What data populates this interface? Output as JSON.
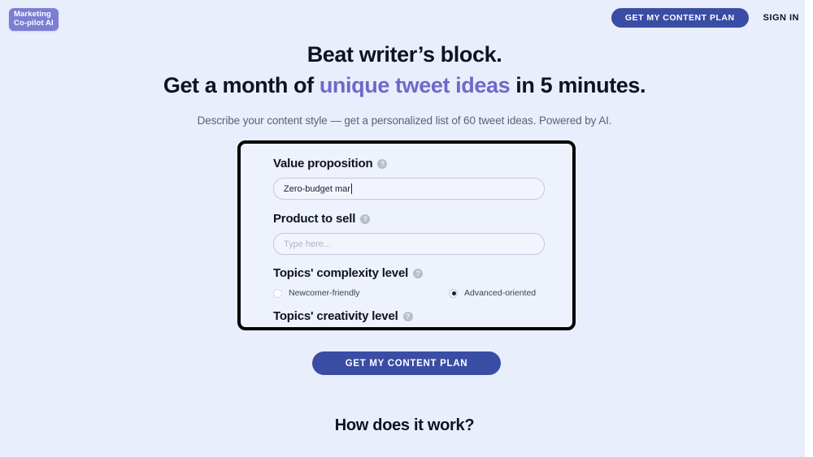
{
  "header": {
    "logo_text": "Marketing\nCo-pilot AI",
    "cta_label": "GET MY CONTENT PLAN",
    "signin_label": "SIGN IN"
  },
  "hero": {
    "headline_line1": "Beat writer’s block.",
    "headline_line2_before": "Get a month of ",
    "headline_line2_accent": "unique tweet ideas",
    "headline_line2_after": " in 5 minutes.",
    "subtitle": "Describe your content style — get a personalized list of 60 tweet ideas. Powered by AI."
  },
  "form": {
    "help_glyph": "?",
    "fields": [
      {
        "label": "Value proposition",
        "value": "Zero-budget mar",
        "placeholder": "Type here..."
      },
      {
        "label": "Product to sell",
        "value": "",
        "placeholder": "Type here..."
      }
    ],
    "complexity": {
      "label": "Topics' complexity level",
      "options": [
        {
          "label": "Newcomer-friendly",
          "selected": false
        },
        {
          "label": "Advanced-oriented",
          "selected": true
        }
      ]
    },
    "creativity": {
      "label": "Topics' creativity level"
    }
  },
  "cta": {
    "label": "GET MY CONTENT PLAN"
  },
  "section": {
    "how_it_works": "How does it work?"
  },
  "colors": {
    "page_background": "#e9eefd",
    "brand_purple": "#7b7fd4",
    "accent_text": "#6f68c9",
    "button_blue": "#3a4da4",
    "card_border": "#000000",
    "card_background": "#eef2fc"
  }
}
